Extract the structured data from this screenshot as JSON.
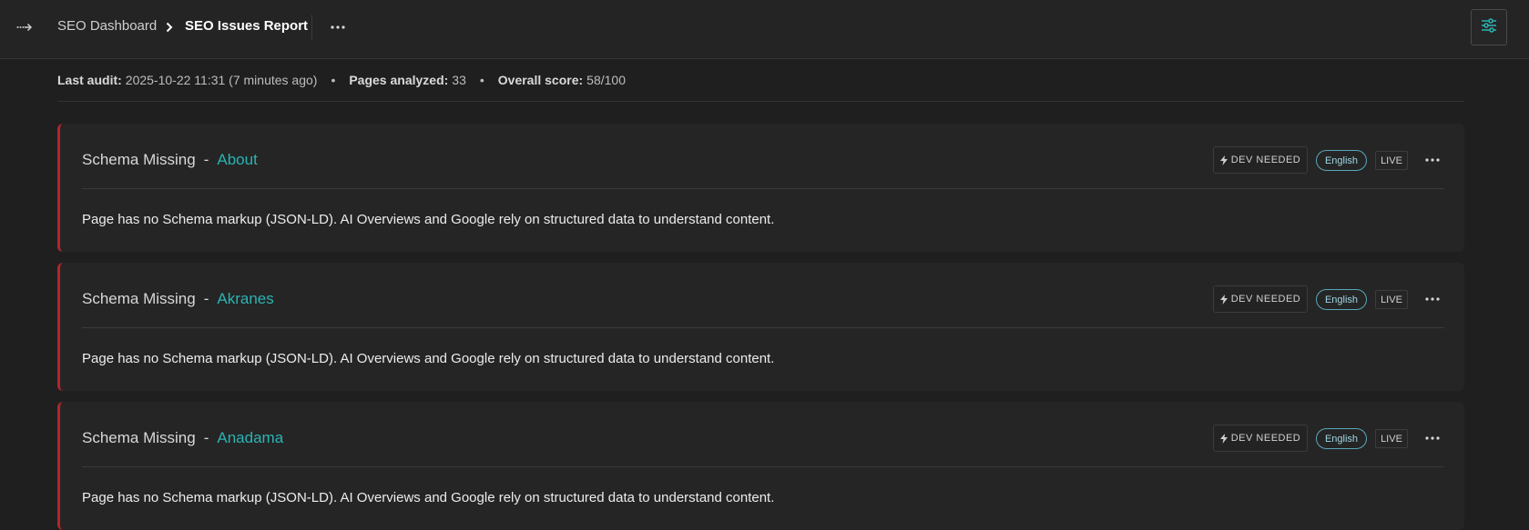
{
  "breadcrumb": {
    "root": "SEO Dashboard",
    "current": "SEO Issues Report"
  },
  "meta": {
    "last_audit_label": "Last audit:",
    "last_audit_value": "2025-10-22 11:31 (7 minutes ago)",
    "pages_label": "Pages analyzed:",
    "pages_value": "33",
    "score_label": "Overall score:",
    "score_value": "58/100"
  },
  "issues": [
    {
      "type": "Schema Missing",
      "separator": "-",
      "page": "About",
      "description": "Page has no Schema markup (JSON-LD). AI Overviews and Google rely on structured data to understand content.",
      "dev_label": "DEV NEEDED",
      "language": "English",
      "status": "LIVE"
    },
    {
      "type": "Schema Missing",
      "separator": "-",
      "page": "Akranes",
      "description": "Page has no Schema markup (JSON-LD). AI Overviews and Google rely on structured data to understand content.",
      "dev_label": "DEV NEEDED",
      "language": "English",
      "status": "LIVE"
    },
    {
      "type": "Schema Missing",
      "separator": "-",
      "page": "Anadama",
      "description": "Page has no Schema markup (JSON-LD). AI Overviews and Google rely on structured data to understand content.",
      "dev_label": "DEV NEEDED",
      "language": "English",
      "status": "LIVE"
    }
  ],
  "icons": {
    "expand": "expand-sidebar-icon",
    "chevron": "chevron-right-icon",
    "more": "more-horizontal-icon",
    "settings": "sliders-icon",
    "bolt": "lightning-icon"
  },
  "colors": {
    "accent": "#2bb3b3",
    "severity": "#b3262b",
    "language_badge": "#5aa6b8"
  }
}
